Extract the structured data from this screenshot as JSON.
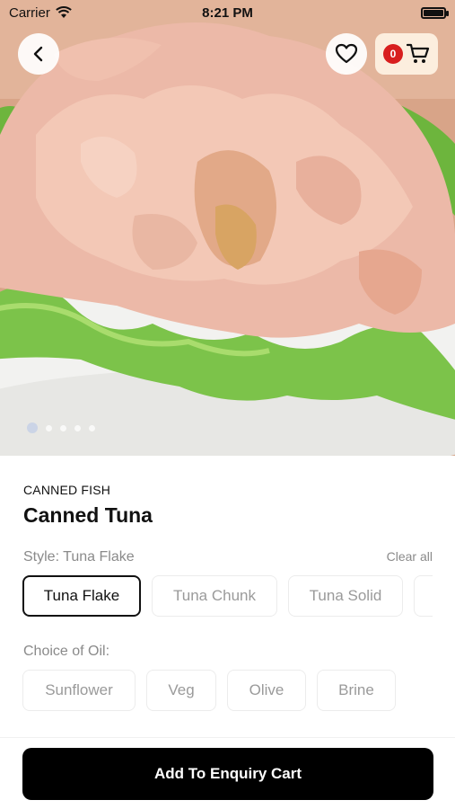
{
  "status_bar": {
    "carrier": "Carrier",
    "time": "8:21 PM"
  },
  "header": {
    "cart_count": "0"
  },
  "gallery": {
    "image_count": 5,
    "active_index": 0
  },
  "product": {
    "category": "CANNED FISH",
    "name": "Canned Tuna"
  },
  "style": {
    "label": "Style: Tuna Flake",
    "clear_label": "Clear all",
    "options": [
      "Tuna Flake",
      "Tuna Chunk",
      "Tuna Solid"
    ],
    "selected": "Tuna Flake"
  },
  "oil": {
    "label": "Choice of Oil:",
    "options": [
      "Sunflower",
      "Veg",
      "Olive",
      "Brine"
    ]
  },
  "cta": {
    "label": "Add To Enquiry Cart"
  },
  "colors": {
    "badge": "#d81e1e",
    "cta_background": "#000000",
    "selected_border": "#111111"
  }
}
